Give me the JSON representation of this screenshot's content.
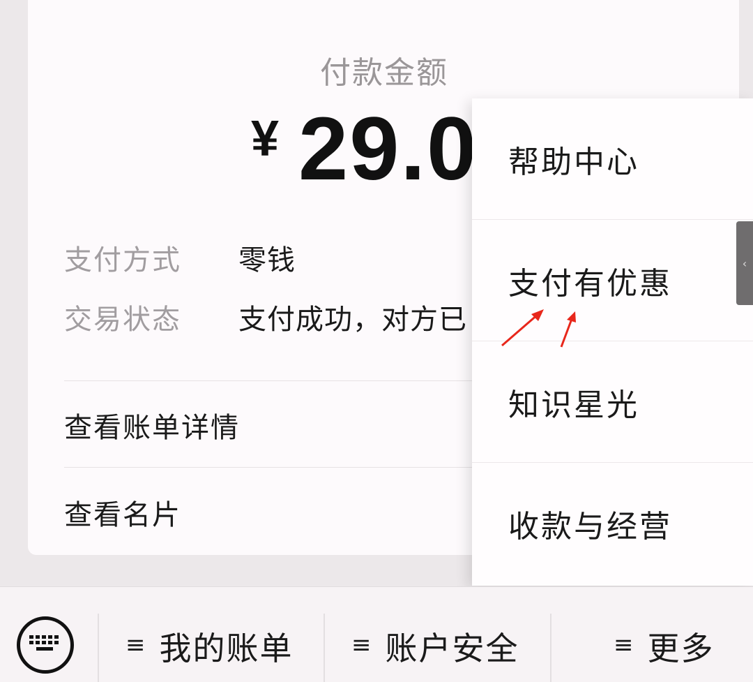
{
  "payment": {
    "amount_label": "付款金额",
    "currency_symbol": "¥",
    "amount_value": "29.0"
  },
  "details": [
    {
      "key": "支付方式",
      "value": "零钱"
    },
    {
      "key": "交易状态",
      "value": "支付成功，对方已"
    }
  ],
  "links": {
    "bill_details": "查看账单详情",
    "view_card": "查看名片"
  },
  "popup_menu": {
    "items": [
      "帮助中心",
      "支付有优惠",
      "知识星光",
      "收款与经营"
    ]
  },
  "side_handle": {
    "glyph": "‹"
  },
  "bottom_bar": {
    "keyboard_icon": "keyboard-icon",
    "hamburger_glyph": "≡",
    "tabs": [
      "我的账单",
      "账户安全",
      "更多"
    ]
  },
  "colors": {
    "annotation_arrow": "#E8271B",
    "background": "#ECE8EA",
    "card": "#FDFAFC"
  }
}
